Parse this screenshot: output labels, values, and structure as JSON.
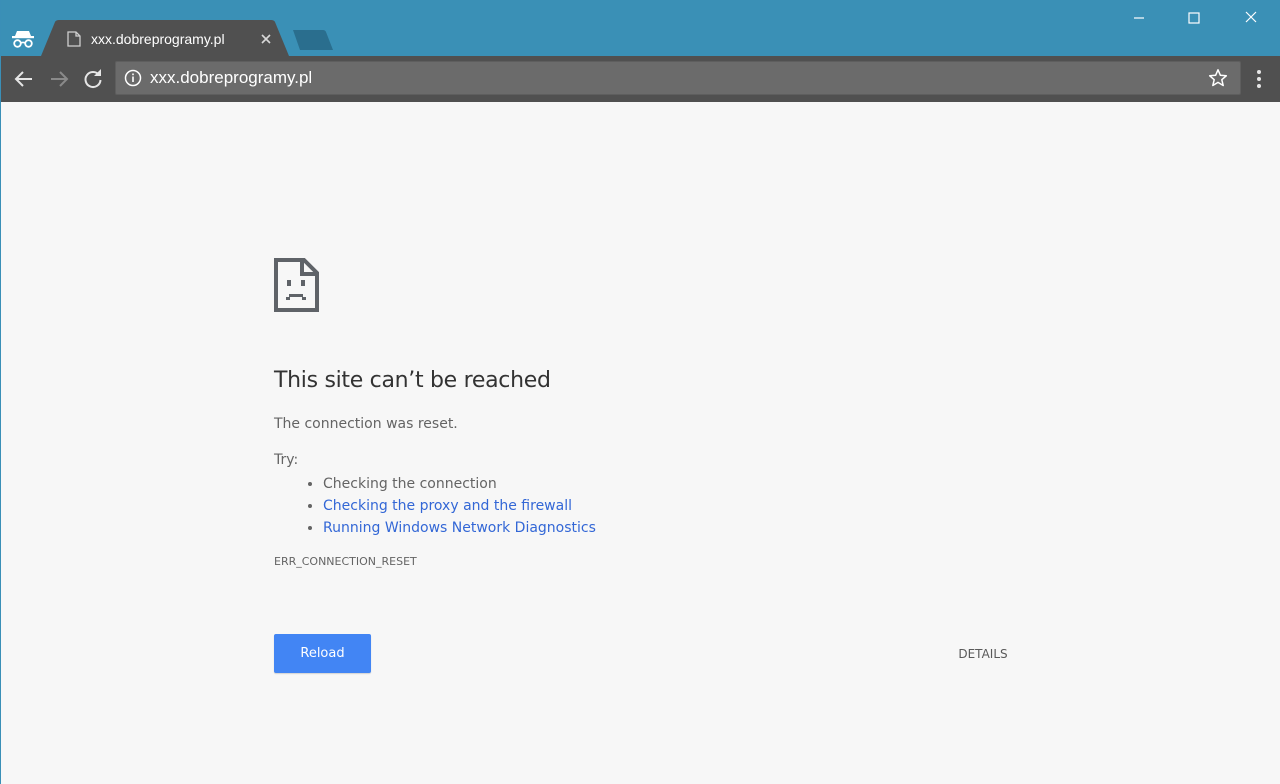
{
  "browser": {
    "tab": {
      "title": "xxx.dobreprogramy.pl"
    },
    "omnibox": {
      "url": "xxx.dobreprogramy.pl"
    },
    "icons": {
      "incognito": "incognito-icon",
      "back": "back-arrow-icon",
      "forward": "forward-arrow-icon",
      "reload": "reload-icon",
      "info": "info-icon",
      "bookmark": "star-icon",
      "menu": "three-dot-menu-icon",
      "minimize": "minimize-icon",
      "maximize": "maximize-icon",
      "close": "close-icon"
    },
    "colors": {
      "titlebar": "#3a90b6",
      "toolbar": "#505050",
      "omnibox": "#6b6b6b"
    }
  },
  "error_page": {
    "icon": "sad-page-icon",
    "heading": "This site can’t be reached",
    "message": "The connection was reset.",
    "try_label": "Try:",
    "suggestions": [
      "Checking the connection",
      "Checking the proxy and the firewall",
      "Running Windows Network Diagnostics"
    ],
    "error_code": "ERR_CONNECTION_RESET",
    "reload_label": "Reload",
    "details_label": "DETAILS",
    "colors": {
      "link": "#3367d6",
      "button": "#4285f4",
      "background": "#f7f7f7"
    }
  }
}
